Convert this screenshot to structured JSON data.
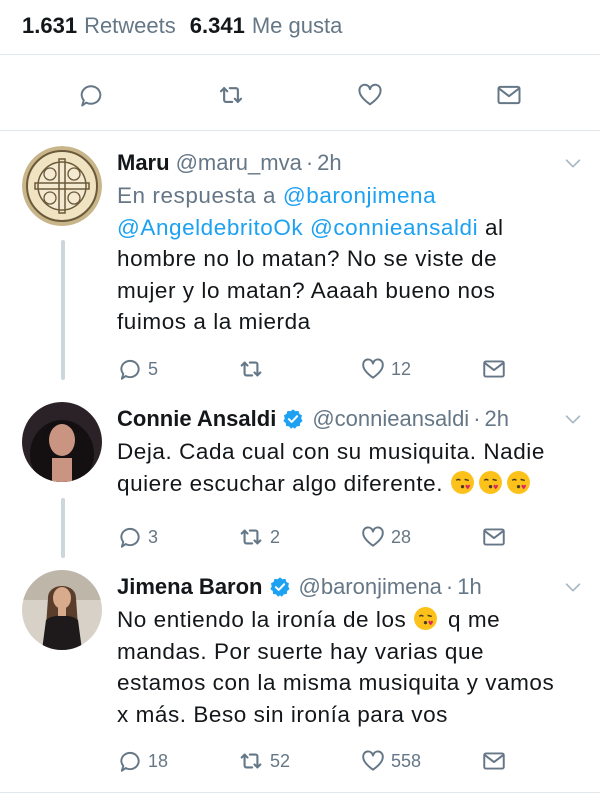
{
  "stats": {
    "retweets_count": "1.631",
    "retweets_label": "Retweets",
    "likes_count": "6.341",
    "likes_label": "Me gusta"
  },
  "icons": {
    "reply": "reply-icon",
    "retweet": "retweet-icon",
    "like": "heart-icon",
    "message": "envelope-icon",
    "more": "chevron-down-icon",
    "verified": "verified-badge-icon",
    "emoji": "face-blowing-kiss-emoji"
  },
  "colors": {
    "link": "#1da1f2",
    "secondary_text": "#657786",
    "primary_text": "#14171a",
    "divider": "#e1e8ed",
    "thread_line": "#ccd6dd"
  },
  "tweets": [
    {
      "name": "Maru",
      "handle": "@maru_mva",
      "separator": "·",
      "time": "2h",
      "reply_prefix": "En respuesta a",
      "reply_to": "@baronjimena",
      "mentions": "@AngeldebritoOk @connieansaldi",
      "text": "al hombre no lo matan? No se viste de mujer y lo matan? Aaaah bueno nos fuimos a la mierda",
      "replies": "5",
      "retweets": "",
      "likes": "12"
    },
    {
      "name": "Connie Ansaldi",
      "handle": "@connieansaldi",
      "separator": "·",
      "time": "2h",
      "verified": true,
      "text": "Deja. Cada cual con su musiquita. Nadie quiere escuchar algo diferente.",
      "replies": "3",
      "retweets": "2",
      "likes": "28"
    },
    {
      "name": "Jimena Baron",
      "handle": "@baronjimena",
      "separator": "·",
      "time": "1h",
      "verified": true,
      "text_before_emoji": "No entiendo la ironía de los",
      "text_after_emoji": "q me mandas. Por suerte hay varias que estamos con la misma musiquita y vamos x más. Beso sin ironía para vos",
      "replies": "18",
      "retweets": "52",
      "likes": "558"
    }
  ]
}
